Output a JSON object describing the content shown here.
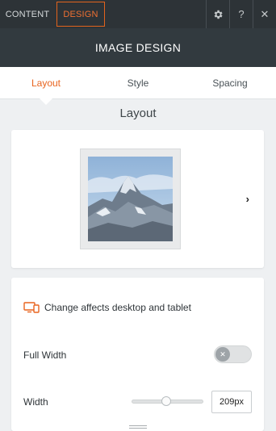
{
  "top_tabs": {
    "content_label": "CONTENT",
    "design_label": "DESIGN"
  },
  "top_icons": {
    "settings": "gear-icon",
    "help_symbol": "?",
    "close_symbol": "✕"
  },
  "header": {
    "title": "IMAGE DESIGN"
  },
  "sub_tabs": [
    {
      "label": "Layout",
      "active": true
    },
    {
      "label": "Style",
      "active": false
    },
    {
      "label": "Spacing",
      "active": false
    }
  ],
  "section_title": "Layout",
  "preview": {
    "next_symbol": "›"
  },
  "settings": {
    "notice": "Change affects desktop and tablet",
    "full_width_label": "Full Width",
    "full_width_on": false,
    "toggle_symbol": "✕",
    "width_label": "Width",
    "width_value": "209px",
    "width_slider_fraction": 0.48
  },
  "colors": {
    "accent": "#e8641f",
    "topbar": "#2d3337",
    "header": "#323a3f"
  }
}
